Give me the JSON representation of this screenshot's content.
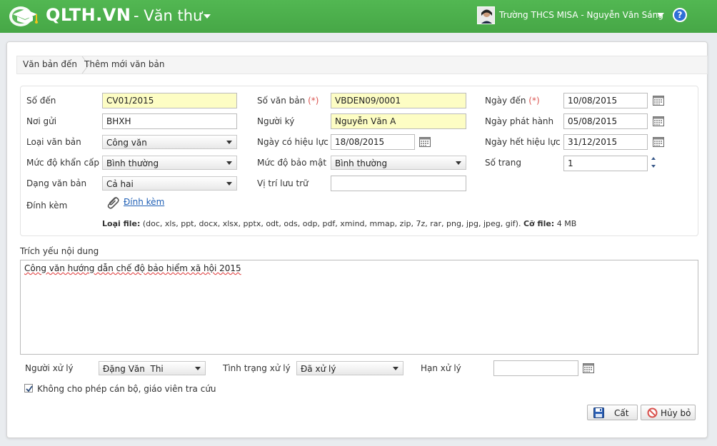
{
  "header": {
    "brand": "QLTH.VN",
    "module": "- Văn thư",
    "user": "Trường THCS MISA - Nguyễn Văn Sáng",
    "help": "?"
  },
  "breadcrumb": {
    "root": "Văn bản đến",
    "current": "Thêm mới văn bản"
  },
  "form": {
    "so_den": {
      "label": "Số đến",
      "value": "CV01/2015"
    },
    "so_van_ban": {
      "label": "Số văn bản",
      "req": "(*)",
      "value": "VBDEN09/0001"
    },
    "ngay_den": {
      "label": "Ngày đến",
      "req": "(*)",
      "value": "10/08/2015"
    },
    "noi_gui": {
      "label": "Nơi gửi",
      "value": "BHXH"
    },
    "nguoi_ky": {
      "label": "Người ký",
      "value": "Nguyễn Văn A"
    },
    "ngay_phat_hanh": {
      "label": "Ngày phát hành",
      "value": "05/08/2015"
    },
    "loai_van_ban": {
      "label": "Loại văn bản",
      "value": "Công văn"
    },
    "ngay_hieu_luc": {
      "label": "Ngày có hiệu lực",
      "value": "18/08/2015"
    },
    "ngay_het_hieu_luc": {
      "label": "Ngày hết hiệu lực",
      "value": "31/12/2015"
    },
    "muc_do_khan": {
      "label": "Mức độ khẩn cấp",
      "value": "Bình thường"
    },
    "muc_do_mat": {
      "label": "Mức độ bảo mật",
      "value": "Bình thường"
    },
    "so_trang": {
      "label": "Số trang",
      "value": "1"
    },
    "dang_van_ban": {
      "label": "Dạng văn bản",
      "value": "Cả hai"
    },
    "vi_tri": {
      "label": "Vị trí lưu trữ",
      "value": ""
    },
    "dinh_kem": {
      "label": "Đính kèm",
      "link": "Đính kèm"
    },
    "file_info": {
      "loai_label": "Loại file:",
      "loai_value": "(doc, xls, ppt, docx, xlsx, pptx, odt, ods, odp, pdf, xmind, mmap, zip, 7z, rar, png, jpg, jpeg, gif).",
      "size_label": "Cỡ file:",
      "size_value": "4 MB"
    }
  },
  "trich_yeu": {
    "label": "Trích yếu nội dung",
    "value": "Công văn hướng dẫn chế độ bảo hiểm xã hội 2015"
  },
  "xu_ly": {
    "nguoi": {
      "label": "Người xử lý",
      "value": "Đặng Văn  Thi"
    },
    "tinh_trang": {
      "label": "Tình trạng xử lý",
      "value": "Đã xử lý"
    },
    "han": {
      "label": "Hạn xử lý",
      "value": ""
    }
  },
  "checkbox": {
    "label": "Không cho phép cán bộ, giáo viên tra cứu",
    "checked": true
  },
  "buttons": {
    "save": "Cất",
    "cancel": "Hủy bỏ"
  },
  "colors": {
    "header_green": "#4cae4c",
    "required_red": "#d9534f",
    "link_blue": "#1f5fb5",
    "highlight_yellow": "#fdfdc4"
  }
}
